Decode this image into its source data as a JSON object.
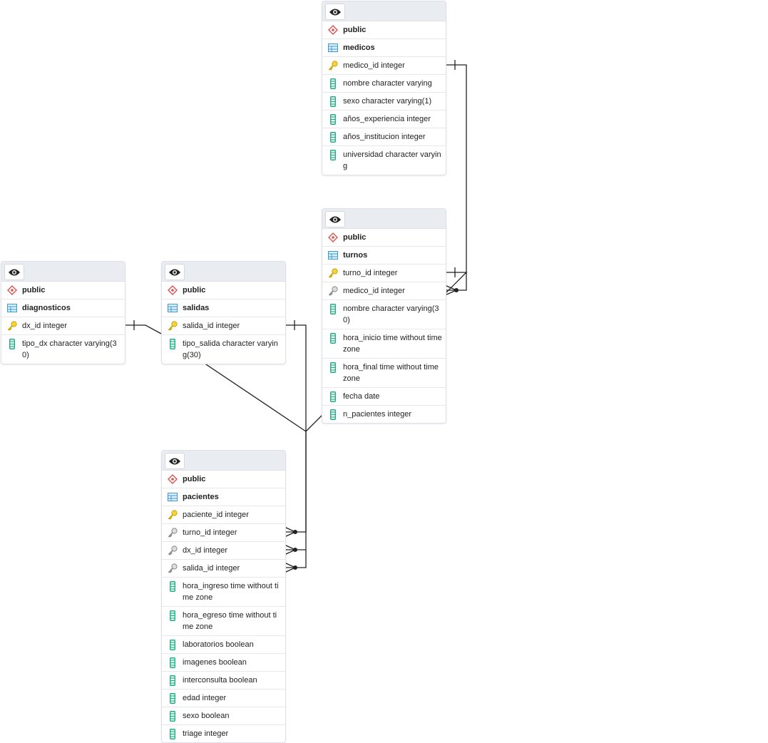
{
  "tables": {
    "medicos": {
      "schema": "public",
      "name": "medicos",
      "columns": [
        {
          "icon": "primary-key",
          "text": "medico_id integer"
        },
        {
          "icon": "column",
          "text": "nombre character varying"
        },
        {
          "icon": "column",
          "text": "sexo character varying(1)"
        },
        {
          "icon": "column",
          "text": "años_experiencia integer"
        },
        {
          "icon": "column",
          "text": "años_institucion integer"
        },
        {
          "icon": "column",
          "text": "universidad character varying"
        }
      ]
    },
    "turnos": {
      "schema": "public",
      "name": "turnos",
      "columns": [
        {
          "icon": "primary-key",
          "text": "turno_id integer"
        },
        {
          "icon": "foreign-key",
          "text": "medico_id integer"
        },
        {
          "icon": "column",
          "text": "nombre character varying(30)"
        },
        {
          "icon": "column",
          "text": "hora_inicio time without time zone"
        },
        {
          "icon": "column",
          "text": "hora_final time without time zone"
        },
        {
          "icon": "column",
          "text": "fecha date"
        },
        {
          "icon": "column",
          "text": "n_pacientes integer"
        }
      ]
    },
    "diagnosticos": {
      "schema": "public",
      "name": "diagnosticos",
      "columns": [
        {
          "icon": "primary-key",
          "text": "dx_id integer"
        },
        {
          "icon": "column",
          "text": "tipo_dx character varying(30)"
        }
      ]
    },
    "salidas": {
      "schema": "public",
      "name": "salidas",
      "columns": [
        {
          "icon": "primary-key",
          "text": "salida_id integer"
        },
        {
          "icon": "column",
          "text": "tipo_salida character varying(30)"
        }
      ]
    },
    "pacientes": {
      "schema": "public",
      "name": "pacientes",
      "columns": [
        {
          "icon": "primary-key",
          "text": "paciente_id integer"
        },
        {
          "icon": "foreign-key",
          "text": "turno_id integer"
        },
        {
          "icon": "foreign-key",
          "text": "dx_id integer"
        },
        {
          "icon": "foreign-key",
          "text": "salida_id integer"
        },
        {
          "icon": "column",
          "text": "hora_ingreso time without time zone"
        },
        {
          "icon": "column",
          "text": "hora_egreso time without time zone"
        },
        {
          "icon": "column",
          "text": "laboratorios boolean"
        },
        {
          "icon": "column",
          "text": "imagenes boolean"
        },
        {
          "icon": "column",
          "text": "interconsulta boolean"
        },
        {
          "icon": "column",
          "text": "edad integer"
        },
        {
          "icon": "column",
          "text": "sexo boolean"
        },
        {
          "icon": "column",
          "text": "triage integer"
        }
      ]
    }
  }
}
